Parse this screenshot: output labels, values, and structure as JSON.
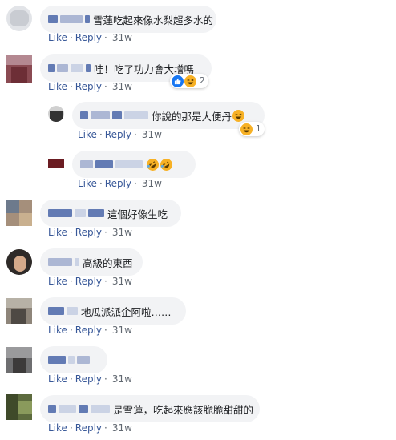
{
  "actions": {
    "like": "Like",
    "reply": "Reply",
    "sep": "·"
  },
  "colors": {
    "like_blue": "#385898",
    "bubble": "#f2f3f5",
    "meta_gray": "#606770",
    "haha_yellow": "#f7b125",
    "like_reaction": "#1877f2"
  },
  "comments": [
    {
      "id": "c1",
      "text": "雪蓮吃起來像水梨超多水的",
      "time": "31w"
    },
    {
      "id": "c2",
      "text": "哇！吃了功力會大增嗎",
      "time": "31w",
      "reaction_count": "2",
      "reaction_icons": [
        "like-icon",
        "haha-icon"
      ]
    },
    {
      "id": "c3",
      "text": "你說的那是大便丹",
      "time": "31w",
      "reaction_count": "1",
      "reaction_icons": [
        "haha-icon"
      ]
    },
    {
      "id": "c4",
      "text": "",
      "time": "31w",
      "emojis": [
        "rolling-laughing-icon",
        "rolling-laughing-icon"
      ]
    },
    {
      "id": "c5",
      "text": "這個好像生吃",
      "time": "31w"
    },
    {
      "id": "c6",
      "text": "高級的東西",
      "time": "31w"
    },
    {
      "id": "c7",
      "text": "地瓜派派企阿啦……",
      "time": "31w"
    },
    {
      "id": "c8",
      "text": "",
      "time": "31w"
    },
    {
      "id": "c9",
      "text": "是雪蓮，吃起來應該脆脆甜甜的",
      "time": "31w"
    }
  ]
}
